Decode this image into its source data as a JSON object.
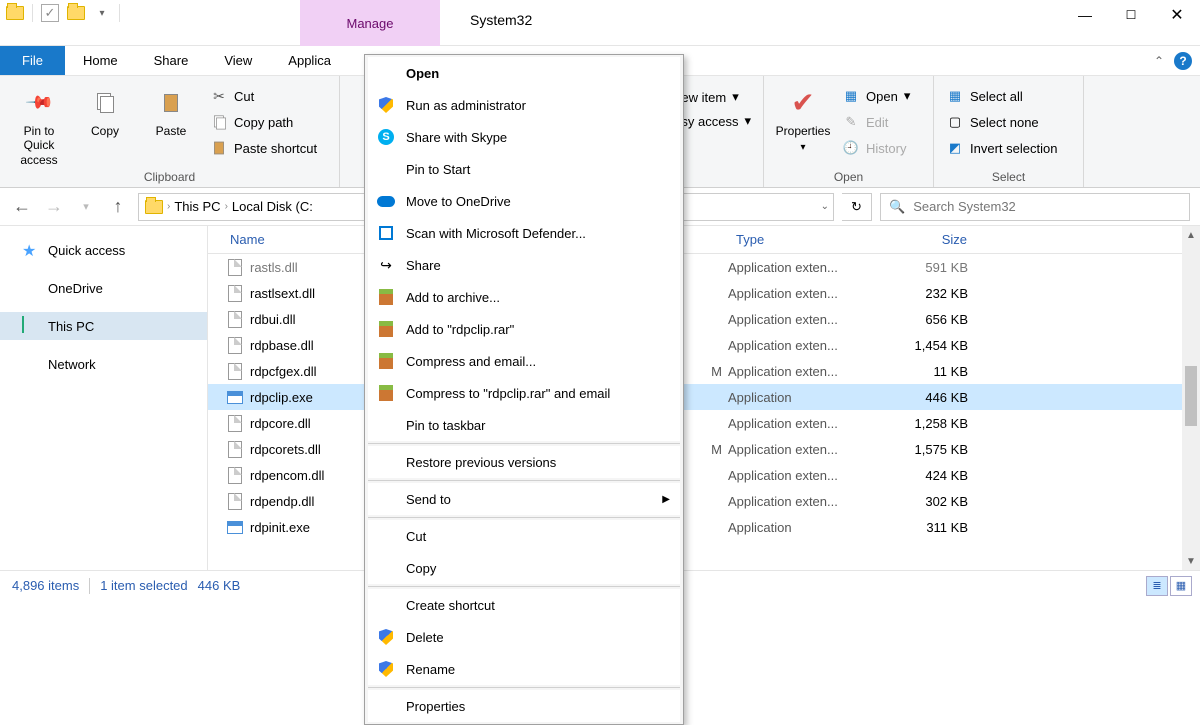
{
  "window": {
    "title": "System32",
    "contextual_tab": "Manage"
  },
  "tabs": {
    "file": "File",
    "home": "Home",
    "share": "Share",
    "view": "View",
    "app_tools": "Applica"
  },
  "ribbon": {
    "clipboard": {
      "label": "Clipboard",
      "pin": "Pin to Quick access",
      "copy": "Copy",
      "paste": "Paste",
      "cut": "Cut",
      "copy_path": "Copy path",
      "paste_shortcut": "Paste shortcut"
    },
    "new": {
      "new_item": "ew item",
      "easy_access": "sy access",
      "dd": "▾"
    },
    "open": {
      "label": "Open",
      "properties": "Properties",
      "open": "Open",
      "edit": "Edit",
      "history": "History",
      "dd": "▾"
    },
    "select": {
      "label": "Select",
      "all": "Select all",
      "none": "Select none",
      "invert": "Invert selection"
    }
  },
  "address": {
    "crumbs": [
      "This PC",
      "Local Disk (C:"
    ],
    "refresh": "↻",
    "search_placeholder": "Search System32"
  },
  "nav": {
    "quick": "Quick access",
    "onedrive": "OneDrive",
    "thispc": "This PC",
    "network": "Network"
  },
  "columns": {
    "name": "Name",
    "date": "",
    "type": "Type",
    "size": "Size"
  },
  "files": [
    {
      "name": "rastls.dll",
      "type": "Application exten...",
      "size": "591 KB",
      "icon": "page",
      "cut": true
    },
    {
      "name": "rastlsext.dll",
      "type": "Application exten...",
      "size": "232 KB",
      "icon": "page"
    },
    {
      "name": "rdbui.dll",
      "type": "Application exten...",
      "size": "656 KB",
      "icon": "page"
    },
    {
      "name": "rdpbase.dll",
      "type": "Application exten...",
      "size": "1,454 KB",
      "icon": "page"
    },
    {
      "name": "rdpcfgex.dll",
      "type": "Application exten...",
      "size": "11 KB",
      "icon": "page",
      "date_suffix": "M"
    },
    {
      "name": "rdpclip.exe",
      "type": "Application",
      "size": "446 KB",
      "icon": "app",
      "selected": true
    },
    {
      "name": "rdpcore.dll",
      "type": "Application exten...",
      "size": "1,258 KB",
      "icon": "page"
    },
    {
      "name": "rdpcorets.dll",
      "type": "Application exten...",
      "size": "1,575 KB",
      "icon": "page",
      "date_suffix": "M"
    },
    {
      "name": "rdpencom.dll",
      "type": "Application exten...",
      "size": "424 KB",
      "icon": "page"
    },
    {
      "name": "rdpendp.dll",
      "type": "Application exten...",
      "size": "302 KB",
      "icon": "page"
    },
    {
      "name": "rdpinit.exe",
      "type": "Application",
      "size": "311 KB",
      "icon": "app"
    }
  ],
  "context": {
    "open": "Open",
    "runas": "Run as administrator",
    "skype": "Share with Skype",
    "pin_start": "Pin to Start",
    "onedrive": "Move to OneDrive",
    "defender": "Scan with Microsoft Defender...",
    "share": "Share",
    "add_archive": "Add to archive...",
    "add_rar": "Add to \"rdpclip.rar\"",
    "compress_email": "Compress and email...",
    "compress_rar_email": "Compress to \"rdpclip.rar\" and email",
    "pin_taskbar": "Pin to taskbar",
    "restore": "Restore previous versions",
    "send_to": "Send to",
    "cut": "Cut",
    "copy": "Copy",
    "shortcut": "Create shortcut",
    "delete": "Delete",
    "rename": "Rename",
    "properties": "Properties"
  },
  "status": {
    "items": "4,896 items",
    "selected": "1 item selected",
    "size": "446 KB"
  }
}
